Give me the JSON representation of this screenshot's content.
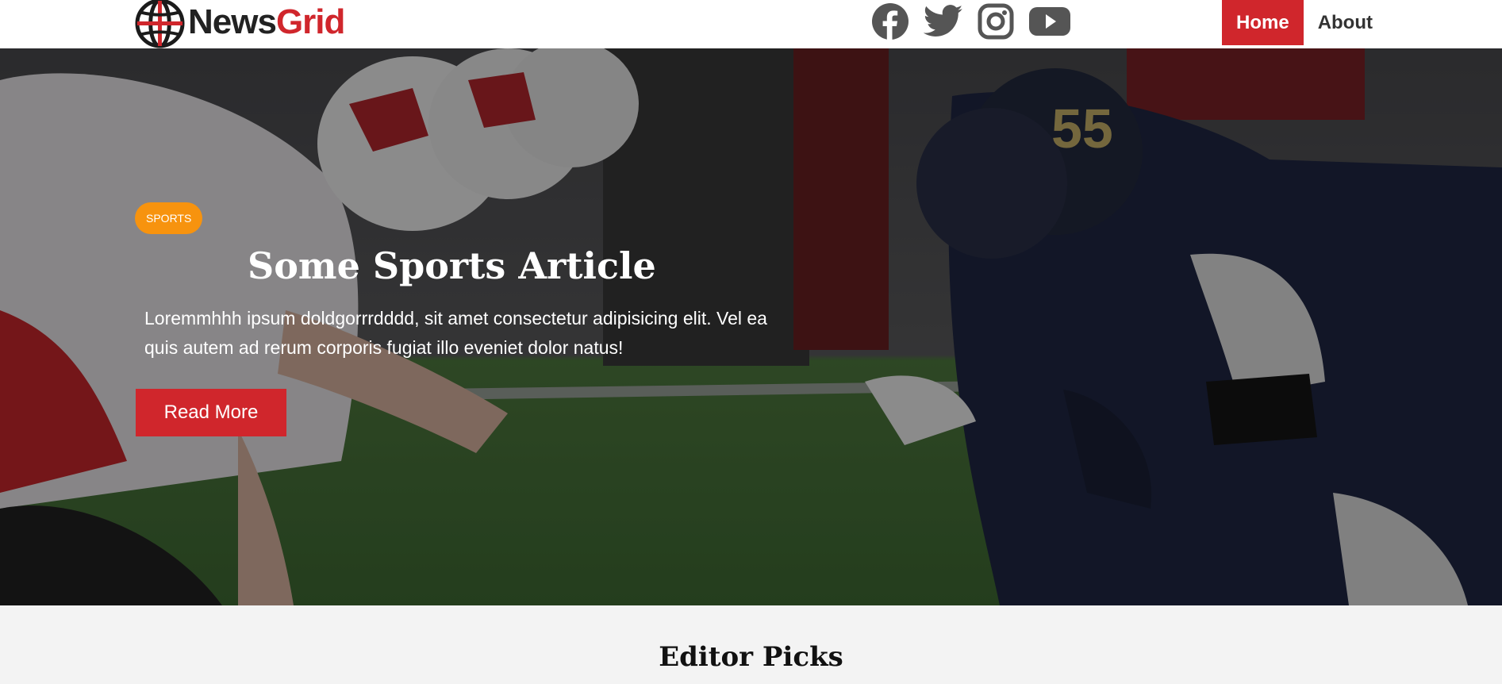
{
  "brand": {
    "name_part1": "News",
    "name_part2": "Grid",
    "accent_color": "#d0262c"
  },
  "social": [
    {
      "name": "facebook-icon"
    },
    {
      "name": "twitter-icon"
    },
    {
      "name": "instagram-icon"
    },
    {
      "name": "youtube-icon"
    }
  ],
  "nav": {
    "links": [
      {
        "label": "Home",
        "active": true
      },
      {
        "label": "About",
        "active": false
      }
    ]
  },
  "hero": {
    "category": "SPORTS",
    "category_color": "#f7930e",
    "title": "Some Sports Article",
    "description": "Loremmhhh ipsum doldgorrrdddd, sit amet consectetur adipisicing elit. Vel ea quis autem ad rerum corporis fugiat illo eveniet dolor natus!",
    "button_label": "Read More"
  },
  "editor_picks": {
    "title": "Editor Picks"
  }
}
